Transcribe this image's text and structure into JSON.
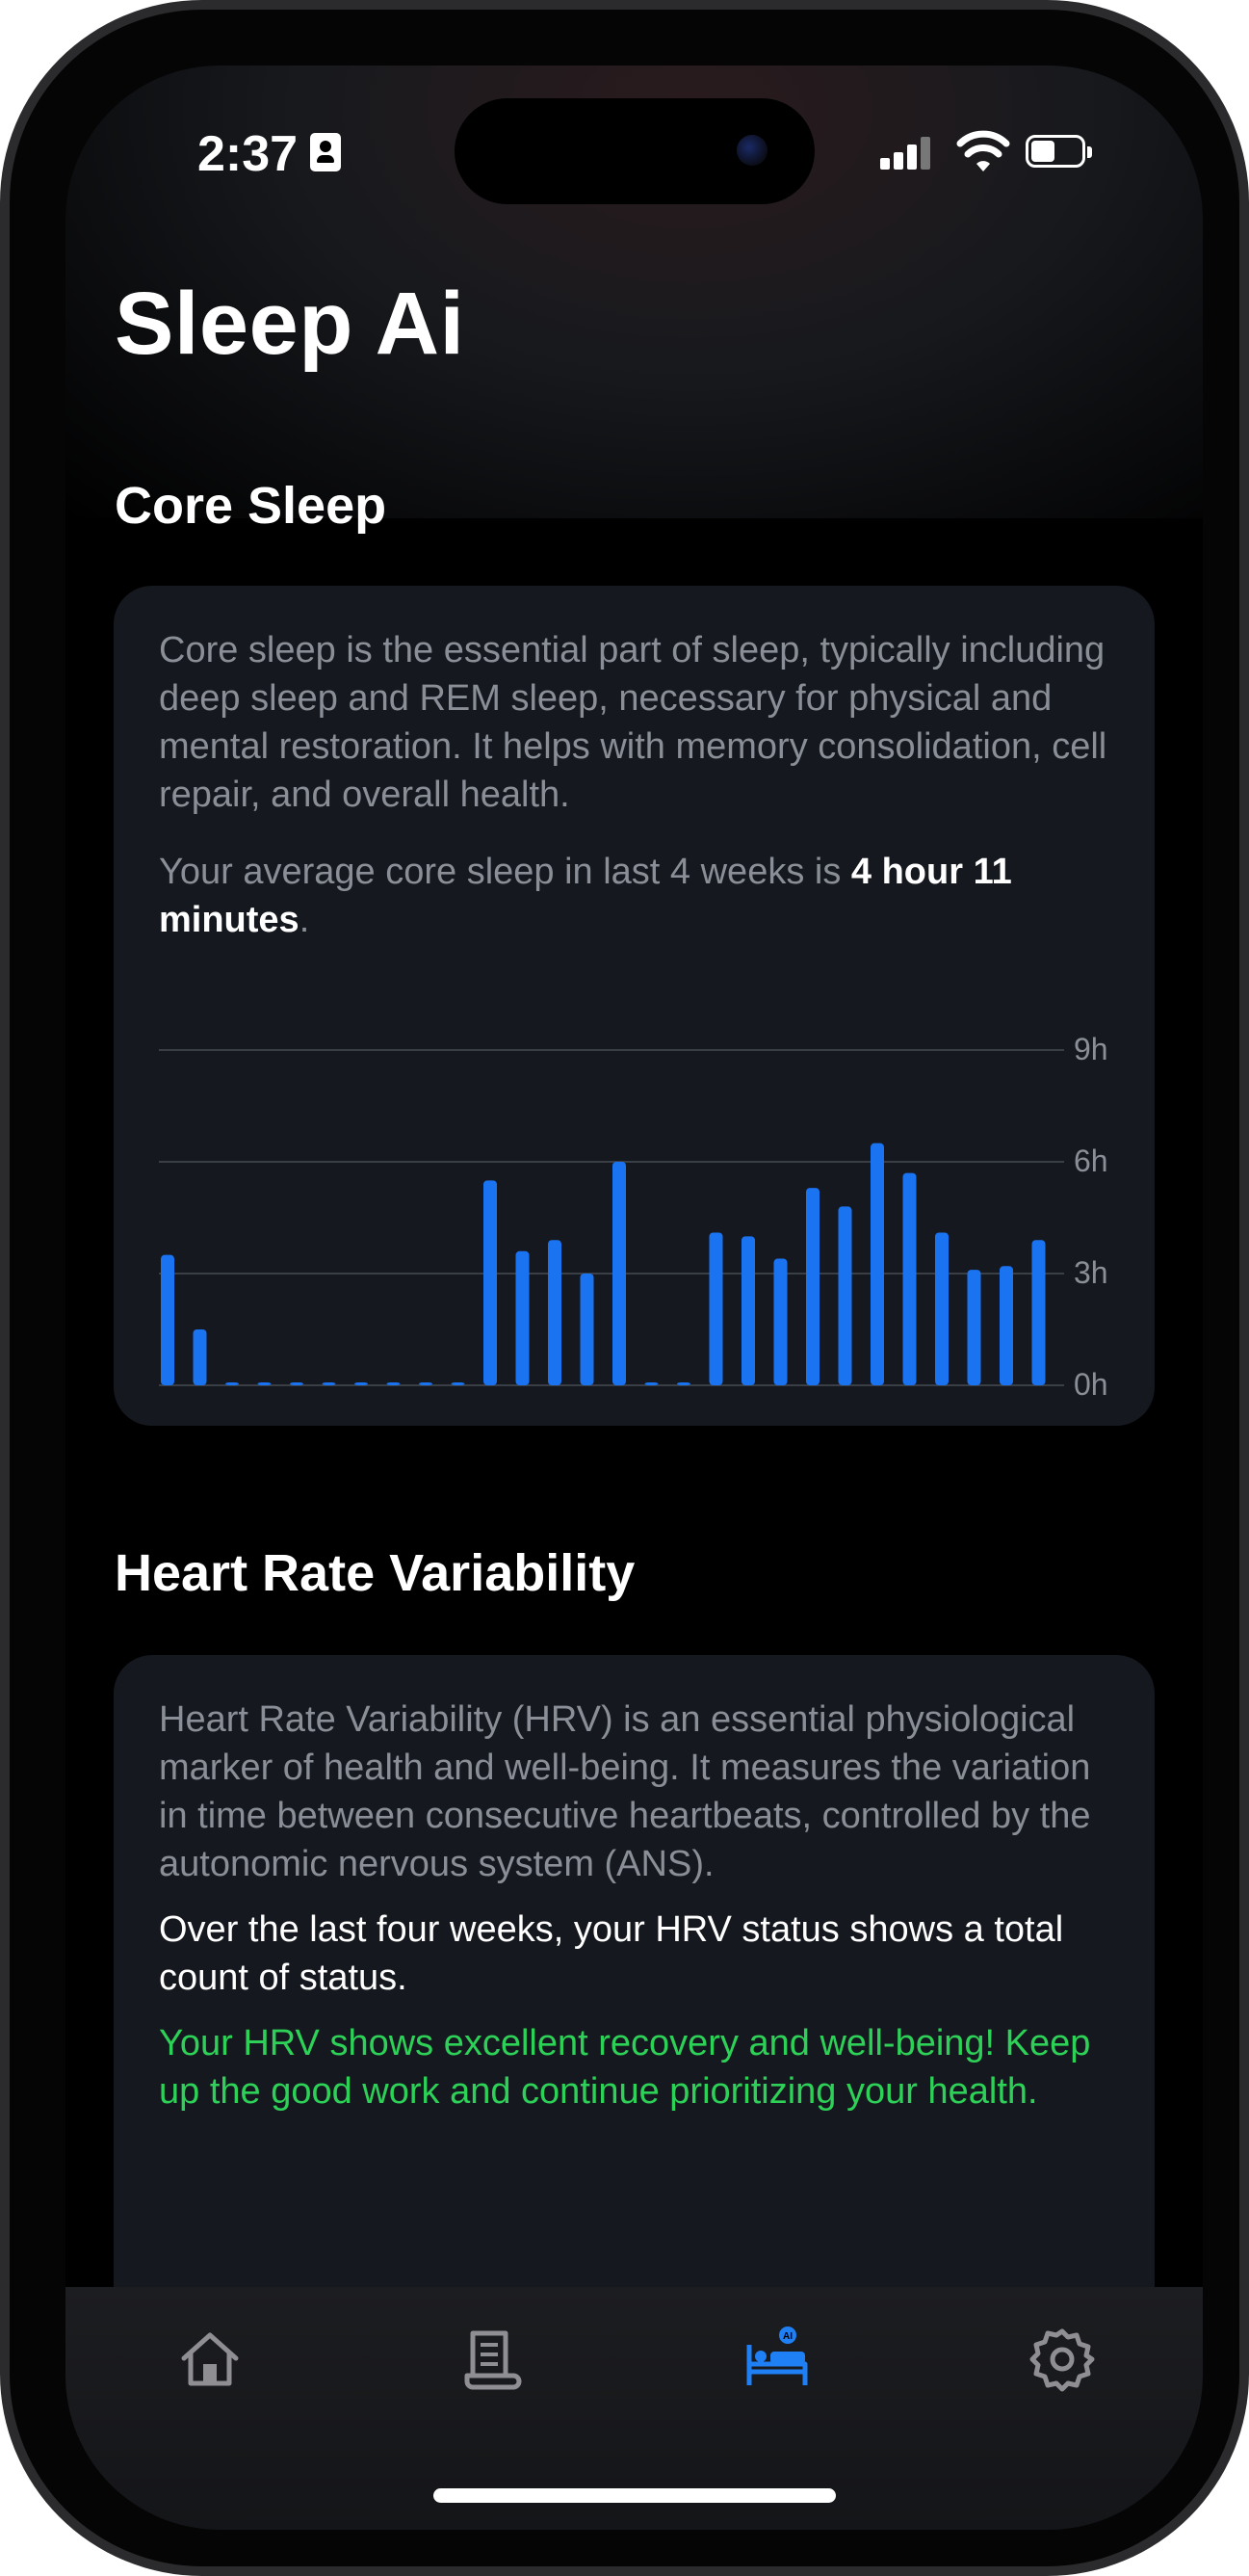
{
  "status_bar": {
    "time": "2:37"
  },
  "app": {
    "title": "Sleep Ai"
  },
  "core_sleep": {
    "title": "Core Sleep",
    "description": "Core sleep is the essential part of sleep, typically including deep sleep and REM sleep, necessary for physical and mental restoration. It helps with memory consolidation, cell repair, and overall health.",
    "average_prefix": "Your average core sleep in last 4 weeks is ",
    "average_value": "4 hour 11 minutes",
    "average_suffix": "."
  },
  "hrv": {
    "title": "Heart Rate Variability",
    "description": "Heart Rate Variability (HRV) is an essential physiological marker of health and well-being. It measures the variation in time between consecutive heartbeats, controlled by the autonomic nervous system (ANS).",
    "status_text": "Over the last four weeks, your HRV status shows a total count of status.",
    "recommendation": "Your HRV shows excellent recovery and well-being! Keep up the good work and continue prioritizing your health."
  },
  "tab_bar": {
    "items": [
      {
        "icon": "home-icon"
      },
      {
        "icon": "scroll-icon"
      },
      {
        "icon": "bed-ai-icon",
        "active": true
      },
      {
        "icon": "gear-icon"
      }
    ],
    "active_color": "#1f7ff4",
    "inactive_color": "#8e8e93"
  },
  "colors": {
    "bar": "#1a73f0",
    "recommendation": "#2ed158",
    "card": "#15181e"
  },
  "chart_data": {
    "type": "bar",
    "y_ticks": [
      "9h",
      "6h",
      "3h",
      "0h"
    ],
    "ylim": [
      0,
      9
    ],
    "grid": true,
    "values": [
      3.5,
      1.5,
      0,
      0,
      0,
      0,
      0,
      0,
      0,
      0,
      5.5,
      3.6,
      3.9,
      3.0,
      6.0,
      0,
      0,
      4.1,
      4.0,
      3.4,
      5.3,
      4.8,
      6.5,
      5.7,
      4.1,
      3.1,
      3.2,
      3.9
    ]
  }
}
